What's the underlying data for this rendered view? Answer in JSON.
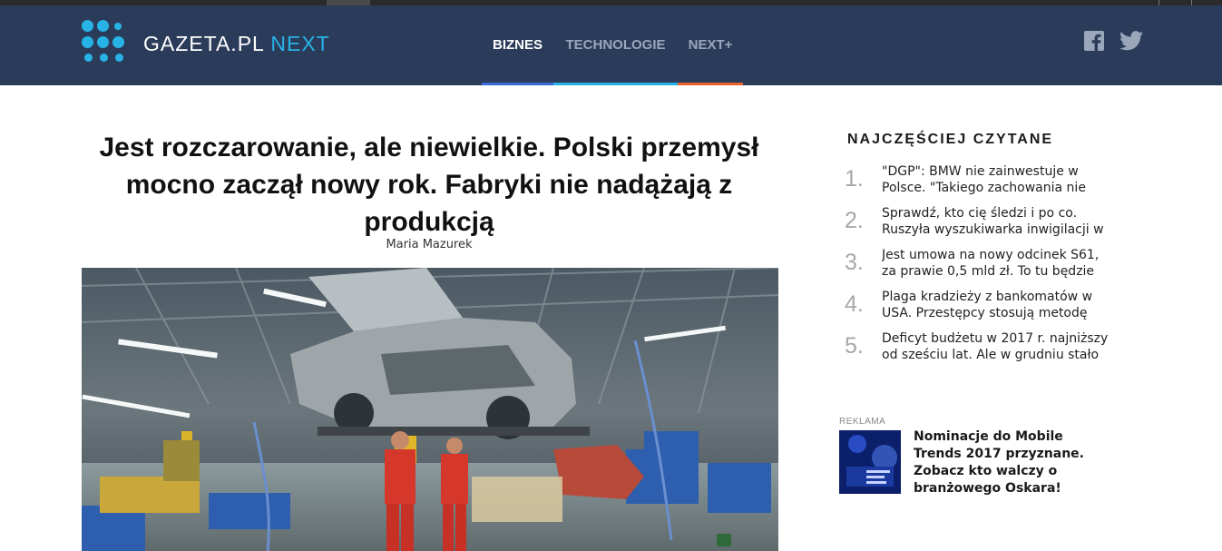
{
  "site": {
    "logo_main": "GAZETA.PL",
    "logo_accent": "NEXT"
  },
  "nav": {
    "items": [
      {
        "label": "BIZNES",
        "active": true,
        "color": "#3a6bd6"
      },
      {
        "label": "TECHNOLOGIE",
        "active": false,
        "color": "#27b3e6"
      },
      {
        "label": "NEXT+",
        "active": false,
        "color": "#e8622a"
      }
    ]
  },
  "social": {
    "facebook_icon": "facebook-icon",
    "twitter_icon": "twitter-icon"
  },
  "article": {
    "title": "Jest rozczarowanie, ale niewielkie. Polski przemysł mocno zaczął nowy rok. Fabryki nie nadążają z produkcją",
    "author": "Maria Mazurek"
  },
  "sidebar": {
    "title": "NAJCZĘŚCIEJ CZYTANE",
    "items": [
      {
        "num": "1.",
        "text": "\"DGP\": BMW nie zainwestuje w Polsce. \"Takiego zachowania nie"
      },
      {
        "num": "2.",
        "text": "Sprawdź, kto cię śledzi i po co. Ruszyła wyszukiwarka inwigilacji w"
      },
      {
        "num": "3.",
        "text": "Jest umowa na nowy odcinek S61, za prawie 0,5 mld zł. To tu będzie"
      },
      {
        "num": "4.",
        "text": "Plaga kradzieży z bankomatów w USA. Przestępcy stosują metodę"
      },
      {
        "num": "5.",
        "text": "Deficyt budżetu w 2017 r. najniższy od sześciu lat. Ale w grudniu stało"
      }
    ]
  },
  "ad": {
    "label": "REKLAMA",
    "text": "Nominacje do Mobile Trends 2017 przyznane. Zobacz kto walczy o branżowego Oskara!"
  },
  "colors": {
    "header_bg": "#2b3c5a",
    "accent": "#27b3e6"
  }
}
